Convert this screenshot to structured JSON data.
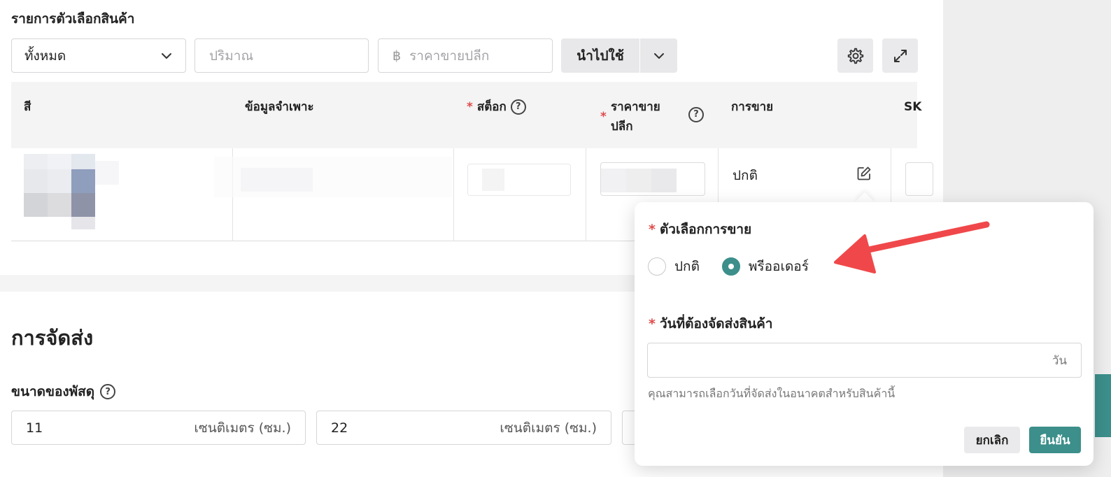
{
  "variants": {
    "title": "รายการตัวเลือกสินค้า",
    "filter_value": "ทั้งหมด",
    "qty_placeholder": "ปริมาณ",
    "price_currency": "฿",
    "price_placeholder": "ราคาขายปลีก",
    "apply_label": "นำไปใช้",
    "columns": {
      "color": "สี",
      "spec": "ข้อมูลจำเพาะ",
      "stock": "สต็อก",
      "price_line1": "ราคาขาย",
      "price_line2": "ปลีก",
      "sales": "การขาย",
      "sku": "SK"
    },
    "row": {
      "sales_mode": "ปกติ"
    },
    "required_mark": "*",
    "help_mark": "?"
  },
  "shipping": {
    "title": "การจัดส่ง",
    "parcel_label": "ขนาดของพัสดุ",
    "dimensions": [
      {
        "value": "11",
        "unit": "เซนติเมตร (ซม.)"
      },
      {
        "value": "22",
        "unit": "เซนติเมตร (ซม.)"
      }
    ]
  },
  "popover": {
    "sale_option_label": "ตัวเลือกการขาย",
    "options": [
      {
        "label": "ปกติ",
        "selected": false
      },
      {
        "label": "พรีออเดอร์",
        "selected": true
      }
    ],
    "ship_days_label": "วันที่ต้องจัดส่งสินค้า",
    "days_unit": "วัน",
    "hint": "คุณสามารถเลือกวันที่จัดส่งในอนาคตสำหรับสินค้านี้",
    "cancel_label": "ยกเลิก",
    "confirm_label": "ยืนยัน"
  },
  "colors": {
    "accent": "#3c8f8b",
    "required": "#e04a4a",
    "arrow": "#f0484a"
  }
}
